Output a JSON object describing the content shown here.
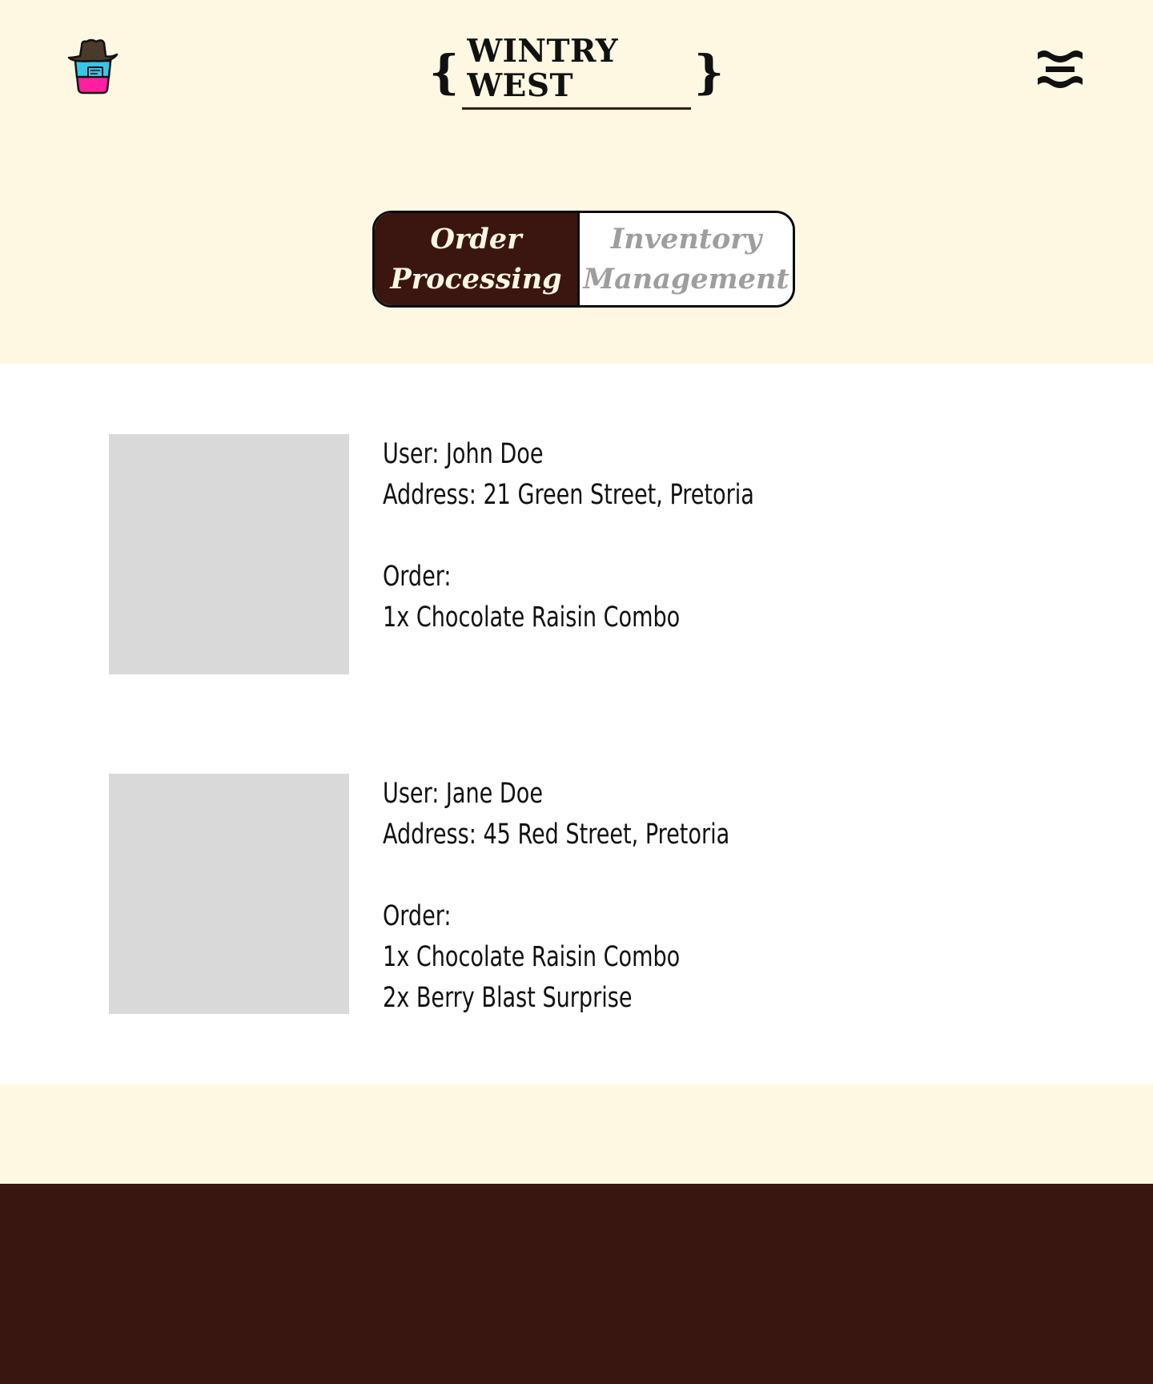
{
  "brand": {
    "title": "WINTRY WEST",
    "left_brace": "{",
    "right_brace": "}"
  },
  "tabs": [
    {
      "label_line1": "Order",
      "label_line2": "Processing",
      "active": true
    },
    {
      "label_line1": "Inventory",
      "label_line2": "Management",
      "active": false
    }
  ],
  "orders": [
    {
      "user": "User: John Doe",
      "address": "Address: 21 Green Street, Pretoria",
      "order_label": "Order:",
      "items": [
        "1x Chocolate Raisin Combo"
      ]
    },
    {
      "user": "User: Jane Doe",
      "address": "Address: 45 Red Street, Pretoria",
      "order_label": "Order:",
      "items": [
        "1x Chocolate Raisin Combo",
        "2x Berry Blast Surprise"
      ]
    }
  ],
  "colors": {
    "cream": "#fef8e2",
    "brown": "#3a1610",
    "placeholder": "#d9d9d9",
    "inactive_text": "#9e9e9e"
  },
  "icons": {
    "logo": "cowboy-cup-logo-icon",
    "menu": "hamburger-menu-icon"
  }
}
